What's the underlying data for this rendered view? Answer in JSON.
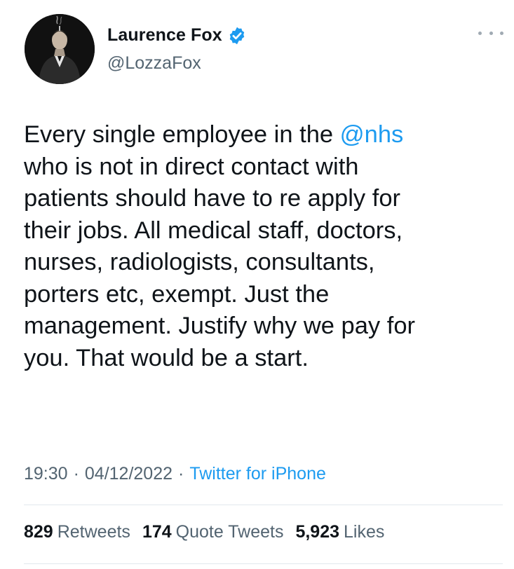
{
  "author": {
    "name": "Laurence Fox",
    "handle": "@LozzaFox",
    "verified": true,
    "avatar_icon": "profile-photo-smoking-silhouette"
  },
  "tweet": {
    "lines": [
      [
        {
          "text": "Every single employee in the "
        },
        {
          "text": "@nhs",
          "mention": true
        }
      ],
      [
        {
          "text": "who is not in direct contact with"
        }
      ],
      [
        {
          "text": "patients should have to re apply for"
        }
      ],
      [
        {
          "text": "their jobs. All medical staff, doctors,"
        }
      ],
      [
        {
          "text": "nurses, radiologists, consultants,"
        }
      ],
      [
        {
          "text": "porters etc, exempt. Just the"
        }
      ],
      [
        {
          "text": "management. Justify why we pay for"
        }
      ],
      [
        {
          "text": "you. That would be a start."
        }
      ]
    ]
  },
  "meta": {
    "time": "19:30",
    "date": "04/12/2022",
    "separator": "·",
    "source": "Twitter for iPhone"
  },
  "stats": {
    "retweets_count": "829",
    "retweets_label": "Retweets",
    "quotes_count": "174",
    "quotes_label": "Quote Tweets",
    "likes_count": "5,923",
    "likes_label": "Likes"
  },
  "more_icon": "more-horizontal-icon",
  "colors": {
    "text": "#0f1419",
    "secondary": "#536471",
    "link": "#1d9bf0",
    "verified": "#1d9bf0",
    "divider": "#e1e8ed"
  }
}
